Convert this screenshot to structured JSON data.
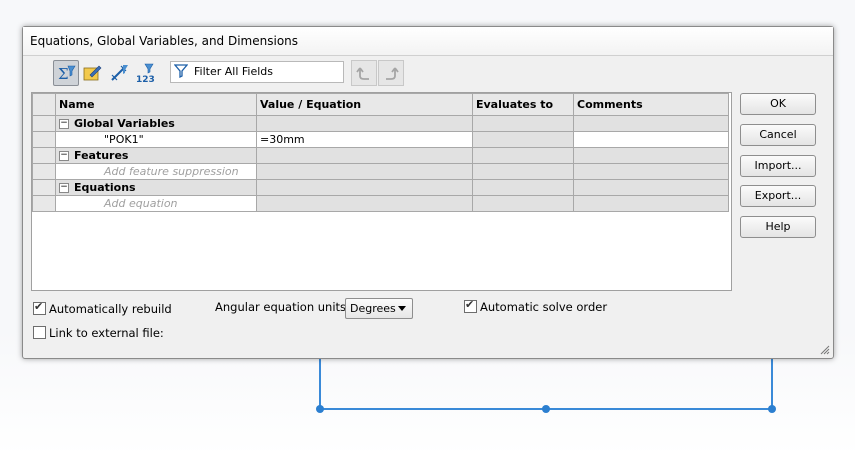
{
  "dialog": {
    "title": "Equations, Global Variables, and Dimensions",
    "filter_placeholder": "Filter All Fields",
    "toolbar_icons": [
      "equation-view-icon",
      "sketch-equation-view-icon",
      "dimension-view-icon",
      "ordered-view-icon"
    ],
    "grid": {
      "columns": [
        "Name",
        "Value / Equation",
        "Evaluates to",
        "Comments"
      ],
      "groups": [
        {
          "label": "Global Variables",
          "rows": [
            {
              "name": "\"POK1\"",
              "value": "=30mm",
              "evaluates": "",
              "comments": ""
            }
          ]
        },
        {
          "label": "Features",
          "placeholder": "Add feature suppression"
        },
        {
          "label": "Equations",
          "placeholder": "Add equation"
        }
      ]
    },
    "buttons": {
      "ok": "OK",
      "cancel": "Cancel",
      "import": "Import...",
      "export": "Export...",
      "help": "Help"
    },
    "options": {
      "auto_rebuild": {
        "label": "Automatically rebuild",
        "checked": true
      },
      "angular_units_label": "Angular equation units:",
      "angular_units_value": "Degrees",
      "auto_solve": {
        "label": "Automatic solve order",
        "checked": true
      },
      "link_external": {
        "label": "Link to external file:",
        "checked": false
      }
    }
  }
}
